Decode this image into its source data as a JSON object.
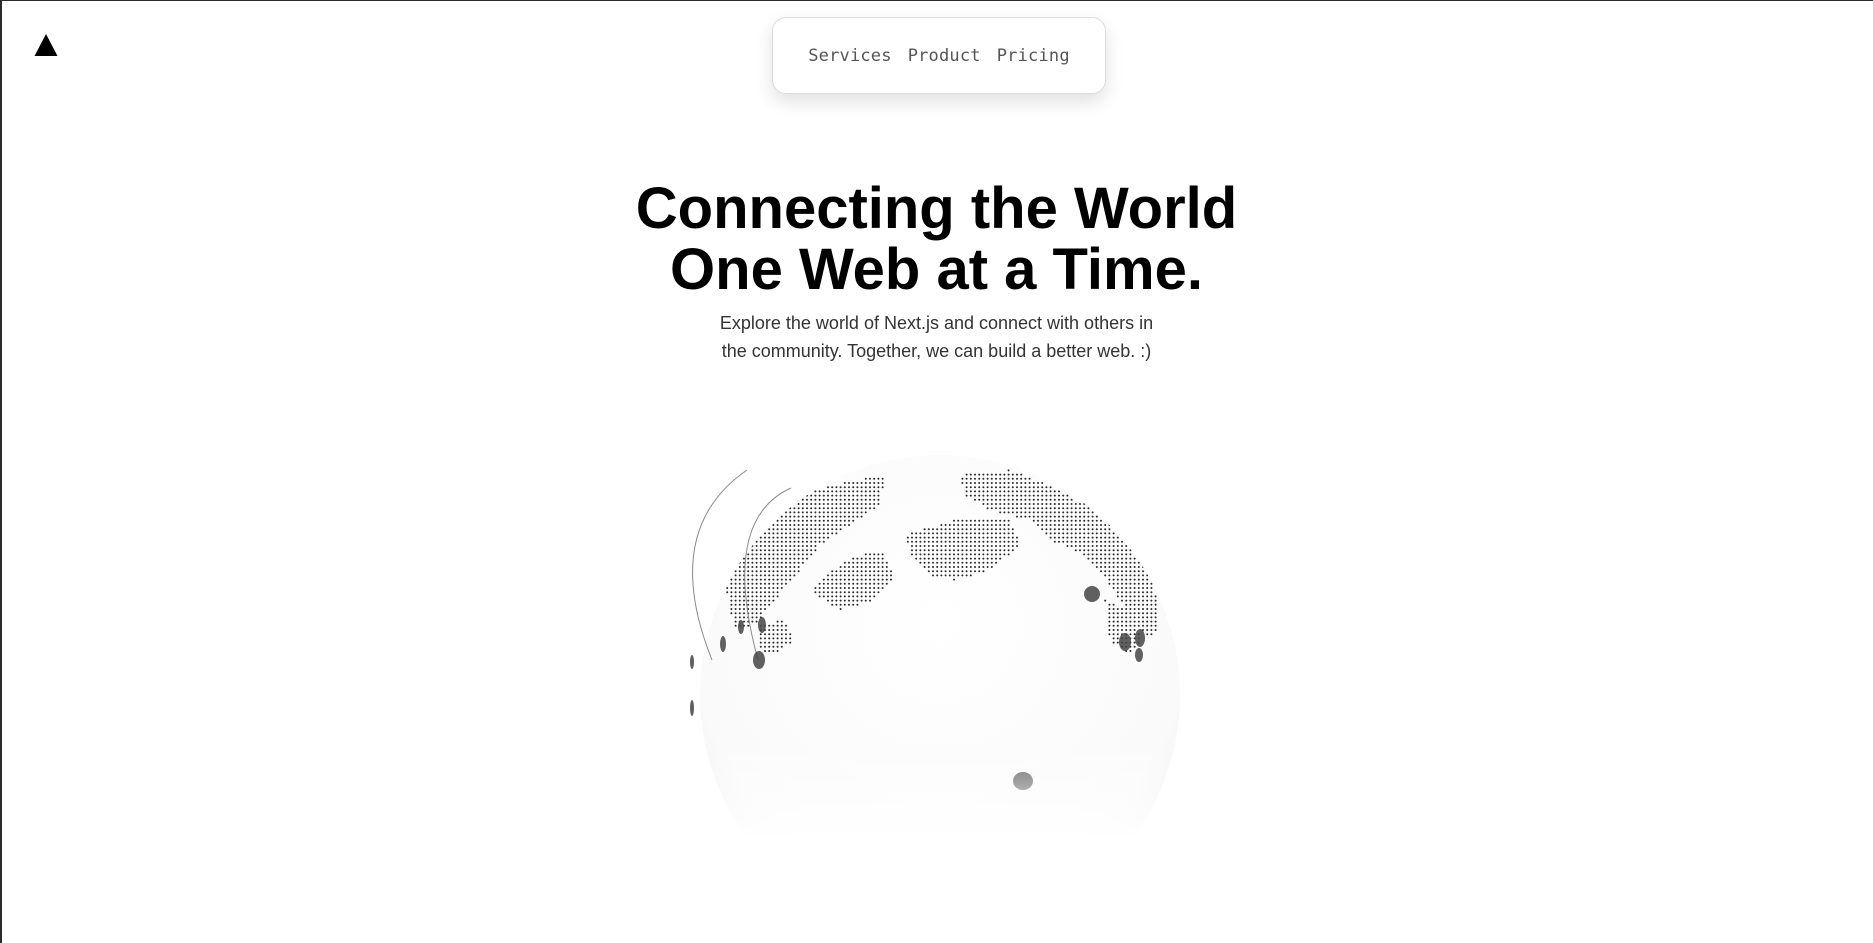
{
  "logo": {
    "icon": "triangle-logo-icon"
  },
  "nav": {
    "items": [
      {
        "label": "Services"
      },
      {
        "label": "Product"
      },
      {
        "label": "Pricing"
      }
    ]
  },
  "hero": {
    "title_line1": "Connecting the World",
    "title_line2": "One Web at a Time.",
    "subtitle": "Explore the world of Next.js and connect with others in the community. Together, we can build a better web. :)"
  },
  "globe": {
    "icon": "globe-illustration"
  },
  "colors": {
    "background": "#ffffff",
    "text": "#000000",
    "subtitle": "#333333",
    "nav_text": "#555555",
    "globe_dots": "#2a2a2a",
    "markers": "#444444"
  }
}
